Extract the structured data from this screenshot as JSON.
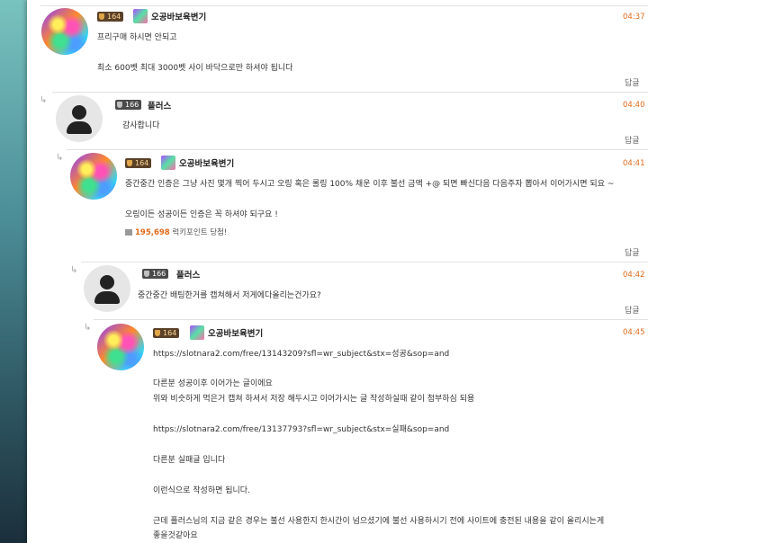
{
  "comments": [
    {
      "nick": "오공바보육변기",
      "level": "164",
      "time": "04:37",
      "lines": [
        "프리구매 하시면 안되고",
        "",
        "최소 600벳 최대 3000벳 사이 바닥으로만 하셔야 됩니다"
      ],
      "reply_label": "답글"
    },
    {
      "nick": "플러스",
      "level": "166",
      "time": "04:40",
      "lines": [
        "감사합니다"
      ],
      "reply_label": "답글"
    },
    {
      "nick": "오공바보육변기",
      "level": "164",
      "time": "04:41",
      "lines": [
        "중간중간 인증은 그냥 사진 몇개 찍어 두시고 오링 혹은 롤링 100% 채운 이후 불선 금액 +@ 되면 빠신다음 다음주자 뽑아서 이어가시면 되요 ~",
        "",
        "오링이든 성공이든 인증은 꼭 하셔야 되구요 !"
      ],
      "points_value": "195,698",
      "points_text": "럭키포인트 당첨!",
      "reply_label": "답글"
    },
    {
      "nick": "플러스",
      "level": "166",
      "time": "04:42",
      "lines": [
        "중간중간 배팅한거를 캡쳐해서 저게에다올리는건가요?"
      ],
      "reply_label": "답글"
    },
    {
      "nick": "오공바보육변기",
      "level": "164",
      "time": "04:45",
      "lines": [
        "https://slotnara2.com/free/13143209?sfl=wr_subject&stx=성공&sop=and",
        "",
        "다른분 성공이후 이어가는 글이에요",
        "위와 비슷하게 먹은거 캡쳐 하셔서 저장 해두시고 이어가시는 글 작성하실때 같이 첨부하심 되용",
        "",
        "https://slotnara2.com/free/13137793?sfl=wr_subject&stx=실패&sop=and",
        "",
        "다른분 실패글 입니다",
        "",
        "이런식으로 작성하면 됩니다.",
        "",
        "근데 플러스님의 지금 같은 경우는 불선 사용한지 한시간이 넘으셨기에 불선 사용하시기 전에 사이트에 충전된 내용을 같이 올리시는게",
        "좋을것같아요"
      ]
    }
  ]
}
